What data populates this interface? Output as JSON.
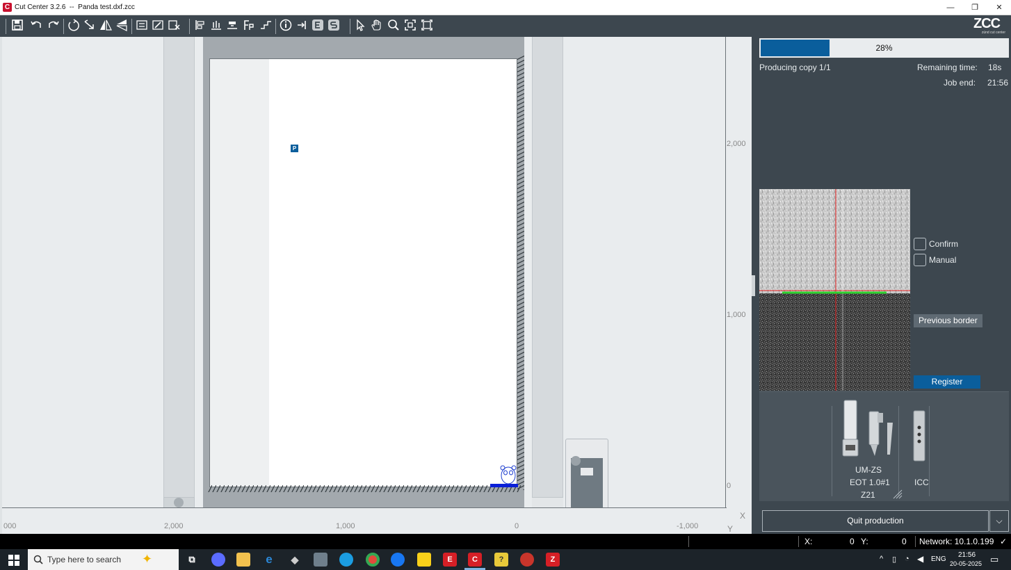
{
  "window": {
    "title": "Cut Center 3.2.6  --  Panda test.dxf.zcc",
    "app_icon_letter": "C",
    "minimize": "—",
    "restore": "❐",
    "close": "✕"
  },
  "toolbar": {
    "icons": [
      "save-icon",
      "undo-icon",
      "redo-icon",
      "rotate-left-icon",
      "rotate-right-icon",
      "mirror-horizontal-icon",
      "mirror-vertical-icon",
      "nest-icon",
      "nest-edit-icon",
      "nest-clear-icon",
      "align-left-icon",
      "distribute-icon",
      "align-bottom-icon",
      "fp-icon",
      "step-icon",
      "info-icon",
      "export-icon",
      "e-icon",
      "s-icon",
      "pointer-icon",
      "hand-icon",
      "zoom-icon",
      "fit-icon",
      "fit-all-icon"
    ],
    "logo_text": "ZCC",
    "logo_subtext": "zünd cut center"
  },
  "canvas": {
    "y_ticks": [
      "2,000",
      "1,000",
      "0"
    ],
    "x_ticks": [
      "000",
      "2,000",
      "1,000",
      "0",
      "-1,000"
    ],
    "x_axis_label": "X",
    "y_axis_label": "Y",
    "marker_label": "P"
  },
  "production": {
    "progress_percent": 28,
    "progress_text": "28%",
    "status": "Producing copy 1/1",
    "remaining_label": "Remaining time:",
    "remaining_value": "18s",
    "job_end_label": "Job end:",
    "job_end_value": "21:56"
  },
  "registration": {
    "confirm_label": "Confirm",
    "manual_label": "Manual",
    "previous_border_label": "Previous border",
    "register_label": "Register"
  },
  "tools": {
    "tool1_name": "UM-ZS",
    "tool1_detail": "EOT 1.0#1",
    "tool1_slot": "Z21",
    "tool2_name": "ICC"
  },
  "quit": {
    "label": "Quit production",
    "dropdown": "⌵"
  },
  "statusbar": {
    "x_label": "X:",
    "x_value": "0",
    "y_label": "Y:",
    "y_value": "0",
    "network": "Network: 10.1.0.199",
    "ok": "✓"
  },
  "taskbar": {
    "search_placeholder": "Type here to search",
    "lang": "ENG",
    "time": "21:56",
    "date": "20-05-2025"
  },
  "colors": {
    "panel": "#3d474f",
    "accent": "#0a5e9c",
    "canvas": "#e9ecee"
  }
}
